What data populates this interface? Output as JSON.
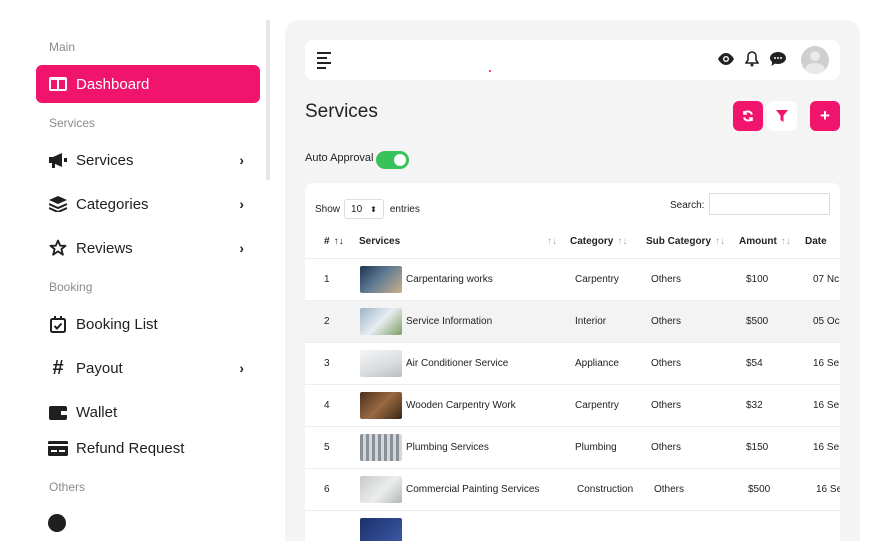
{
  "sidebar": {
    "sections": {
      "main": "Main",
      "services": "Services",
      "booking": "Booking",
      "others": "Others"
    },
    "items": [
      {
        "label": "Dashboard",
        "icon": "dashboard-icon"
      },
      {
        "label": "Services",
        "icon": "megaphone-icon"
      },
      {
        "label": "Categories",
        "icon": "layers-icon"
      },
      {
        "label": "Reviews",
        "icon": "star-icon"
      },
      {
        "label": "Booking List",
        "icon": "calendar-check-icon"
      },
      {
        "label": "Payout",
        "icon": "hash-icon"
      },
      {
        "label": "Wallet",
        "icon": "wallet-icon"
      },
      {
        "label": "Refund Request",
        "icon": "refund-icon"
      }
    ]
  },
  "header": {
    "title": "Services"
  },
  "auto_approval": {
    "label": "Auto Approval",
    "enabled": true
  },
  "table": {
    "show_label": "Show",
    "entries_value": "10",
    "entries_label": "entries",
    "search_label": "Search:",
    "columns": [
      "#",
      "Services",
      "Category",
      "Sub Category",
      "Amount",
      "Date"
    ],
    "rows": [
      {
        "n": "1",
        "service": "Carpentaring works",
        "category": "Carpentry",
        "sub": "Others",
        "amount": "$100",
        "date": "07 Nc"
      },
      {
        "n": "2",
        "service": "Service Information",
        "category": "Interior",
        "sub": "Others",
        "amount": "$500",
        "date": "05 Oc"
      },
      {
        "n": "3",
        "service": "Air Conditioner Service",
        "category": "Appliance",
        "sub": "Others",
        "amount": "$54",
        "date": "16 Se"
      },
      {
        "n": "4",
        "service": "Wooden Carpentry Work",
        "category": "Carpentry",
        "sub": "Others",
        "amount": "$32",
        "date": "16 Se"
      },
      {
        "n": "5",
        "service": "Plumbing Services",
        "category": "Plumbing",
        "sub": "Others",
        "amount": "$150",
        "date": "16 Se"
      },
      {
        "n": "6",
        "service": "Commercial Painting Services",
        "category": "Construction",
        "sub": "Others",
        "amount": "$500",
        "date": "16 Se"
      }
    ]
  },
  "colors": {
    "accent": "#f0146c",
    "toggle": "#3ac25a"
  }
}
